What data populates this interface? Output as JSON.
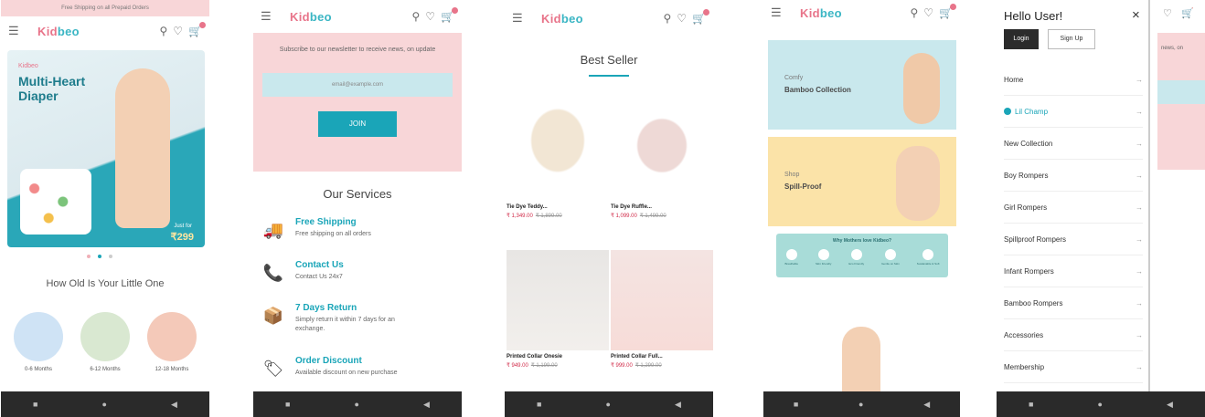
{
  "screen1": {
    "topbar": "Free Shipping on all Prepaid Orders",
    "logo_a": "Kid",
    "logo_b": "beo",
    "hero_logo": "Kidbeo",
    "hero_title": "Multi-Heart Diaper",
    "hero_just_for": "Just for",
    "hero_price": "₹299",
    "section_title": "How Old Is Your Little One",
    "ages": [
      "0-6 Months",
      "6-12 Months",
      "12-18 Months"
    ]
  },
  "screen2": {
    "newsletter_text": "Subscribe to our newsletter to receive news, on update",
    "email_placeholder": "email@example.com",
    "join_label": "JOIN",
    "services_title": "Our Services",
    "services": [
      {
        "title": "Free Shipping",
        "desc": "Free shipping on all orders"
      },
      {
        "title": "Contact Us",
        "desc": "Contact Us 24x7"
      },
      {
        "title": "7 Days Return",
        "desc": "Simply return it within 7 days for an exchange."
      },
      {
        "title": "Order Discount",
        "desc": "Available discount on new purchase"
      }
    ]
  },
  "screen3": {
    "title": "Best Seller",
    "products": [
      {
        "name": "Tie Dye Teddy...",
        "price": "₹ 1,349.00",
        "mrp": "₹ 1,899.00"
      },
      {
        "name": "Tie Dye Ruffle...",
        "price": "₹ 1,099.00",
        "mrp": "₹ 1,499.00"
      },
      {
        "name": "Printed Collar Onesie",
        "price": "₹ 949.00",
        "mrp": "₹ 1,199.00"
      },
      {
        "name": "Printed Collar Full...",
        "price": "₹ 999.00",
        "mrp": "₹ 1,299.00"
      }
    ]
  },
  "screen4": {
    "banner1_small": "Comfy",
    "banner1_big": "Bamboo Collection",
    "banner2_small": "Shop",
    "banner2_big": "Spill-Proof",
    "why_title": "Why Mothers love Kidbeo?",
    "why_items": [
      "Breathable",
      "Skin Friendly",
      "Eco Friendly",
      "Gentle on Skin",
      "Sustainable & Soft"
    ]
  },
  "screen5": {
    "greeting": "Hello User!",
    "close": "×",
    "login_label": "Login",
    "signup_label": "Sign Up",
    "menu": [
      "Home",
      "Lil Champ",
      "New Collection",
      "Boy Rompers",
      "Girl Rompers",
      "Spillproof Rompers",
      "Infant Rompers",
      "Bamboo Rompers",
      "Accessories",
      "Membership"
    ],
    "behind_text": "news, on"
  },
  "navbar": [
    "■",
    "●",
    "◀"
  ],
  "icons": {
    "menu": "☰",
    "search": "⚲",
    "heart": "♡",
    "cart": "🛒"
  },
  "colors": {
    "pink": "#e8748a",
    "teal": "#1aa5b8",
    "pinkbg": "#f8d6d8",
    "blue": "#c9e8ed",
    "yellow": "#fbe3a8"
  }
}
